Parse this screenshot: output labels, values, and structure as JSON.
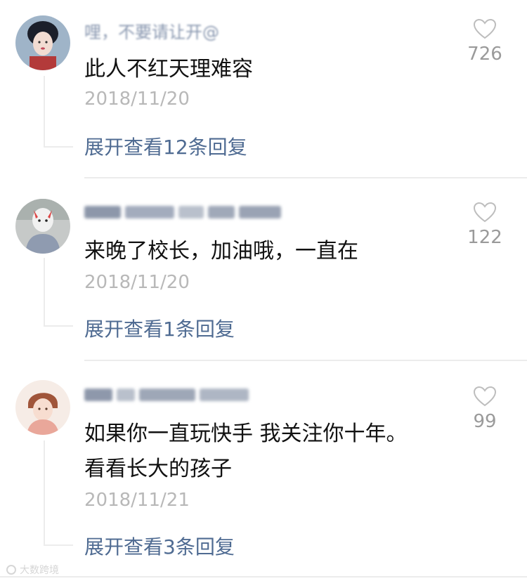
{
  "comments": [
    {
      "username": "哩，不要请让开@",
      "text": "此人不红天理难容",
      "date": "2018/11/20",
      "likes": "726",
      "replies": "展开查看12条回复"
    },
    {
      "username": "",
      "text": "来晚了校长，加油哦，一直在",
      "date": "2018/11/20",
      "likes": "122",
      "replies": "展开查看1条回复"
    },
    {
      "username": "",
      "text_line1": "如果你一直玩快手 我关注你十年。",
      "text_line2": "看看长大的孩子",
      "date": "2018/11/21",
      "likes": "99",
      "replies": "展开查看3条回复"
    }
  ],
  "watermark": "大数跨境",
  "colors": {
    "reply_link": "#4f6b92",
    "date": "#b8b8b8",
    "like_count": "#9a9a9a"
  }
}
